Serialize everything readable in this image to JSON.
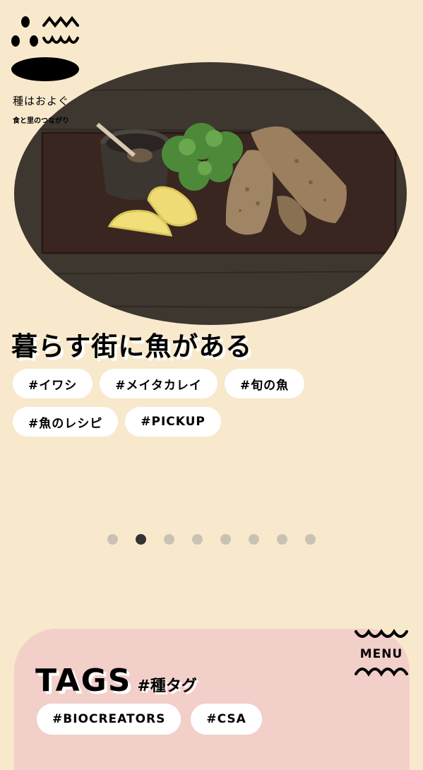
{
  "brand": {
    "name": "種はおよぐ",
    "tagline": "食と里のつながり"
  },
  "hero": {
    "image_alt": "fish-fry-plate",
    "title": "暮らす街に魚がある"
  },
  "hero_tags": [
    "#イワシ",
    "#メイタカレイ",
    "#旬の魚",
    "#魚のレシピ",
    "#PICKUP"
  ],
  "carousel": {
    "total": 8,
    "active": 2
  },
  "tags_section": {
    "title": "TAGS",
    "subtitle": "#種タグ",
    "tags": [
      "#BIOCREATORS",
      "#CSA"
    ]
  },
  "menu": {
    "label": "MENU"
  },
  "colors": {
    "background": "#f8e9cc",
    "panel": "#f3cfca",
    "dot_active": "#333333",
    "dot": "#c9c2b4"
  }
}
